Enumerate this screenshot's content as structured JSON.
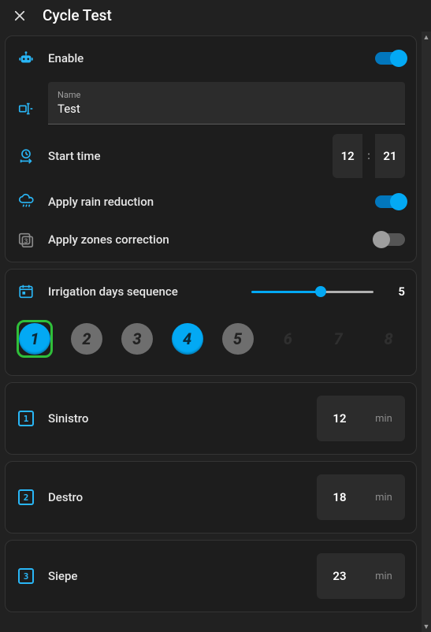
{
  "header": {
    "title": "Cycle Test"
  },
  "settings": {
    "enable": {
      "label": "Enable",
      "value": true
    },
    "name": {
      "field_label": "Name",
      "value": "Test"
    },
    "start_time": {
      "label": "Start time",
      "hour": "12",
      "minute": "21"
    },
    "rain": {
      "label": "Apply rain reduction",
      "value": true
    },
    "zones_corr": {
      "label": "Apply zones correction",
      "value": false
    }
  },
  "sequence": {
    "label": "Irrigation days sequence",
    "value": 5,
    "max": 8,
    "selected_day": 1,
    "days": [
      {
        "n": "1",
        "state": "active"
      },
      {
        "n": "2",
        "state": "mid"
      },
      {
        "n": "3",
        "state": "mid"
      },
      {
        "n": "4",
        "state": "active"
      },
      {
        "n": "5",
        "state": "mid"
      },
      {
        "n": "6",
        "state": "inactive"
      },
      {
        "n": "7",
        "state": "inactive"
      },
      {
        "n": "8",
        "state": "inactive"
      }
    ]
  },
  "zones": [
    {
      "index": "1",
      "name": "Sinistro",
      "minutes": "12",
      "unit": "min"
    },
    {
      "index": "2",
      "name": "Destro",
      "minutes": "18",
      "unit": "min"
    },
    {
      "index": "3",
      "name": "Siepe",
      "minutes": "23",
      "unit": "min"
    }
  ],
  "colors": {
    "accent": "#03a9f4",
    "icon": "#29b6f6",
    "success": "#2fbf3a"
  }
}
